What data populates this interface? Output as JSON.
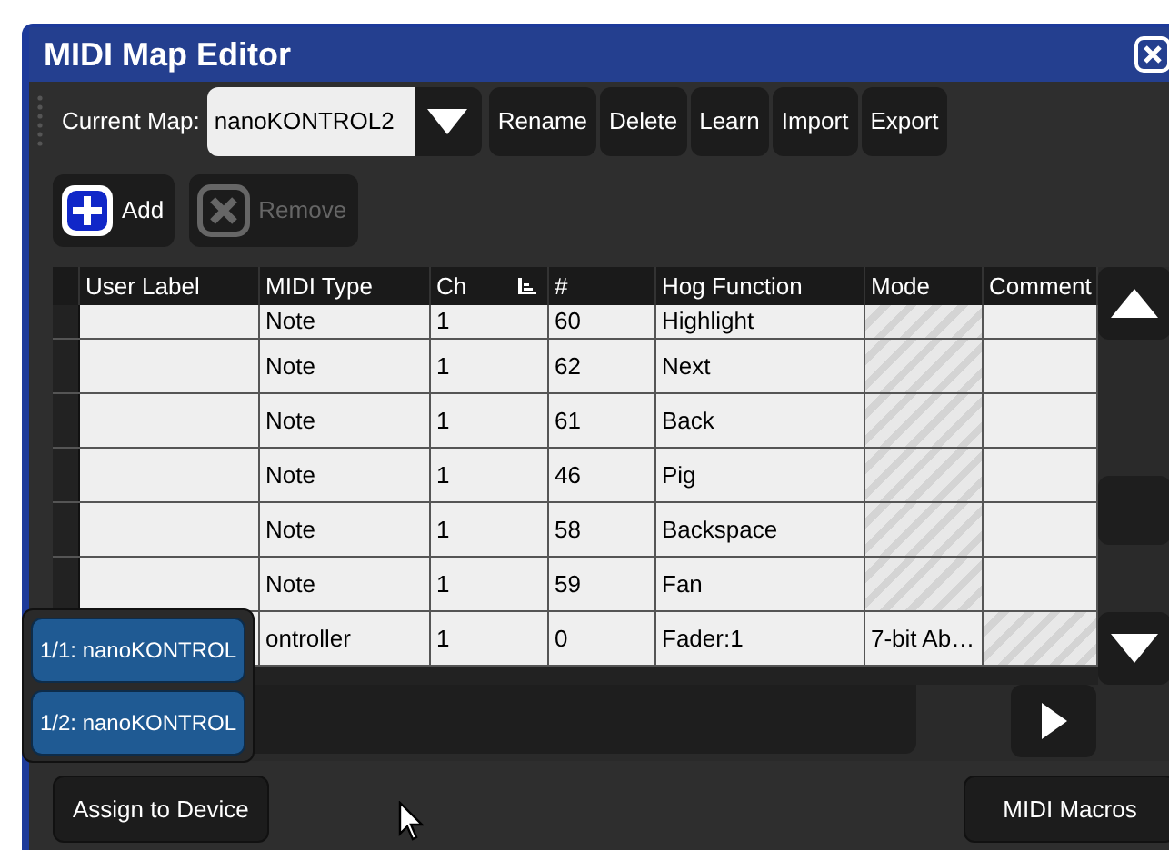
{
  "window": {
    "title": "MIDI Map Editor"
  },
  "toolbar": {
    "map_label": "Current Map:",
    "map_value": "nanoKONTROL2",
    "buttons": [
      "Rename",
      "Delete",
      "Learn",
      "Import",
      "Export"
    ]
  },
  "actions": [
    {
      "kind": "add",
      "label": "Add",
      "disabled": false
    },
    {
      "kind": "remove",
      "label": "Remove",
      "disabled": true
    }
  ],
  "table": {
    "columns": [
      "User Label",
      "MIDI Type",
      "Ch",
      "#",
      "Hog Function",
      "Mode",
      "Comment"
    ],
    "rows": [
      {
        "user_label": "",
        "midi_type": "Note",
        "ch": "1",
        "number": "60",
        "hog_function": "Highlight",
        "mode": "",
        "mode_unavailable": true,
        "comment_unavailable": false
      },
      {
        "user_label": "",
        "midi_type": "Note",
        "ch": "1",
        "number": "62",
        "hog_function": "Next",
        "mode": "",
        "mode_unavailable": true,
        "comment_unavailable": false
      },
      {
        "user_label": "",
        "midi_type": "Note",
        "ch": "1",
        "number": "61",
        "hog_function": "Back",
        "mode": "",
        "mode_unavailable": true,
        "comment_unavailable": false
      },
      {
        "user_label": "",
        "midi_type": "Note",
        "ch": "1",
        "number": "46",
        "hog_function": "Pig",
        "mode": "",
        "mode_unavailable": true,
        "comment_unavailable": false
      },
      {
        "user_label": "",
        "midi_type": "Note",
        "ch": "1",
        "number": "58",
        "hog_function": "Backspace",
        "mode": "",
        "mode_unavailable": true,
        "comment_unavailable": false
      },
      {
        "user_label": "",
        "midi_type": "Note",
        "ch": "1",
        "number": "59",
        "hog_function": "Fan",
        "mode": "",
        "mode_unavailable": true,
        "comment_unavailable": false
      },
      {
        "user_label": "",
        "midi_type": "ontroller",
        "ch": "1",
        "number": "0",
        "hog_function": "Fader:1",
        "mode": "7-bit Ab…",
        "mode_unavailable": false,
        "comment_unavailable": true
      }
    ]
  },
  "popup": {
    "items": [
      "1/1: nanoKONTROL",
      "1/2: nanoKONTROL"
    ]
  },
  "footer": {
    "assign_button": "Assign to Device",
    "macros_button": "MIDI Macros"
  }
}
